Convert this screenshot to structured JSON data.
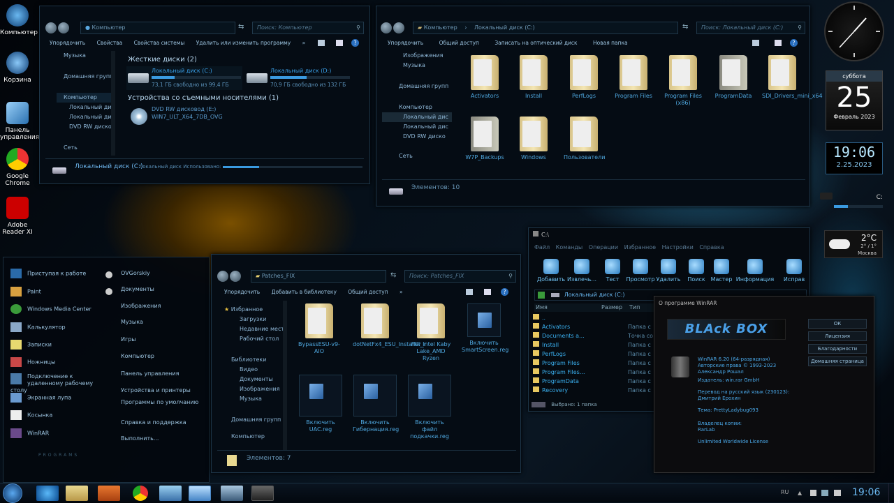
{
  "desktop": {
    "icons": [
      {
        "label": "Компьютер",
        "icon": "computer-icon"
      },
      {
        "label": "Корзина",
        "icon": "recycle-bin-icon"
      },
      {
        "label": "Панель управления",
        "icon": "control-panel-icon"
      },
      {
        "label": "Google Chrome",
        "icon": "chrome-icon"
      },
      {
        "label": "Adobe Reader XI",
        "icon": "adobe-reader-icon"
      }
    ]
  },
  "win_computer": {
    "address": "Компьютер",
    "search": "Поиск: Компьютер",
    "toolbar": [
      "Упорядочить",
      "Свойства",
      "Свойства системы",
      "Удалить или изменить программу",
      "»"
    ],
    "sidebar": [
      "Музыка",
      "Домашняя групп",
      "Компьютер",
      "Локальный диск",
      "Локальный диск",
      "DVD RW диско",
      "Сеть"
    ],
    "hdd_group": "Жесткие диски (2)",
    "removable_group": "Устройства со съемными носителями (1)",
    "drives": [
      {
        "name": "Локальный диск (C:)",
        "free": "73,1 ГБ свободно из 99,4 ГБ",
        "used_fraction": 0.26
      },
      {
        "name": "Локальный диск (D:)",
        "free": "70,9 ГБ свободно из 132 ГБ",
        "used_fraction": 0.46
      }
    ],
    "dvd": {
      "name": "DVD RW дисковод (E:)",
      "label": "WIN7_ULT_X64_7DB_OVG"
    },
    "details_title": "Локальный диск (C:)",
    "details_text": "Локальный диск Использовано:"
  },
  "win_c": {
    "address": [
      "Компьютер",
      "Локальный диск (C:)"
    ],
    "search": "Поиск: Локальный диск (C:)",
    "toolbar": [
      "Упорядочить",
      "Общий доступ",
      "Записать на оптический диск",
      "Новая папка"
    ],
    "sidebar": [
      "Изображения",
      "Музыка",
      "Домашняя групп",
      "Компьютер",
      "Локальный дис",
      "Локальный дис",
      "DVD RW диско",
      "Сеть"
    ],
    "folders": [
      "Activators",
      "Install",
      "PerfLogs",
      "Program Files",
      "Program Files (x86)",
      "ProgramData",
      "SDI_Drivers_mini_x64",
      "W7P_Backups",
      "Windows",
      "Пользователи"
    ],
    "status": "Элементов: 10"
  },
  "win_patches": {
    "address": "Patches_FIX",
    "search": "Поиск: Patches_FIX",
    "toolbar": [
      "Упорядочить",
      "Добавить в библиотеку",
      "Общий доступ",
      "»"
    ],
    "sidebar": [
      "Избранное",
      "Загрузки",
      "Недавние мест",
      "Рабочий стол",
      "Библиотеки",
      "Видео",
      "Документы",
      "Изображения",
      "Музыка",
      "Домашняя групп",
      "Компьютер"
    ],
    "items": [
      "BypassESU-v9-AIO",
      "dotNetFx4_ESU_Installer_r",
      "FIX_Intel Kaby Lake_AMD Ryzen",
      "Включить SmartScreen.reg",
      "Включить UAC.reg",
      "Включить Гибернация.reg",
      "Включить файл подкачки.reg"
    ],
    "status": "Элементов: 7"
  },
  "start_menu": {
    "left": [
      "Приступая к работе",
      "Paint",
      "Windows Media Center",
      "Калькулятор",
      "Записки",
      "Ножницы",
      "Подключение к удаленному рабочему столу",
      "Экранная лупа",
      "Косынка",
      "WinRAR"
    ],
    "right": [
      "OVGorskiy",
      "Документы",
      "Изображения",
      "Музыка",
      "Игры",
      "Компьютер",
      "Панель управления",
      "Устройства и принтеры",
      "Программы по умолчанию",
      "Справка и поддержка",
      "Выполнить..."
    ],
    "footer": "PROGRAMS"
  },
  "winrar": {
    "title": "C:\\",
    "menu": [
      "Файл",
      "Команды",
      "Операции",
      "Избранное",
      "Настройки",
      "Справка"
    ],
    "tools": [
      "Добавить",
      "Извлечь...",
      "Тест",
      "Просмотр",
      "Удалить",
      "Поиск",
      "Мастер",
      "Информация",
      "Исправ"
    ],
    "path": "Локальный диск (C:)",
    "columns": [
      "Имя",
      "Размер",
      "Тип"
    ],
    "rows": [
      {
        "name": "..",
        "type": ""
      },
      {
        "name": "Activators",
        "type": "Папка с"
      },
      {
        "name": "Documents a...",
        "type": "Точка со"
      },
      {
        "name": "Install",
        "type": "Папка с"
      },
      {
        "name": "PerfLogs",
        "type": "Папка с"
      },
      {
        "name": "Program Files",
        "type": "Папка с"
      },
      {
        "name": "Program Files...",
        "type": "Папка с"
      },
      {
        "name": "ProgramData",
        "type": "Папка с"
      },
      {
        "name": "Recovery",
        "type": "Папка с"
      }
    ],
    "status": "Выбрано: 1 папка"
  },
  "about": {
    "title": "О программе WinRAR",
    "logo": "BLAck BOX",
    "lines": [
      "WinRAR 6.20 (64-разрядная)",
      "Авторские права © 1993-2023",
      "Александр Рошал",
      "Издатель: win.rar GmbH",
      "",
      "Перевод на русский язык (230123):",
      "Дмитрий Ерохин",
      "",
      "Тема: PrettyLadybug093",
      "",
      "Владелец копии:",
      "RarLab",
      "",
      "Unlimited Worldwide License"
    ],
    "buttons": [
      "ОК",
      "Лицензия",
      "Благодарности",
      "Домашняя страница"
    ]
  },
  "gadgets": {
    "calendar": {
      "weekday": "суббота",
      "day": "25",
      "month": "Февраль 2023"
    },
    "digital_clock": {
      "time": "19:06",
      "date": "2.25.2023"
    },
    "drive": {
      "label": "C:"
    },
    "weather": {
      "temp": "2°C",
      "range": "2° / 1°",
      "city": "Москва"
    }
  },
  "taskbar": {
    "lang": "RU",
    "time": "19:06"
  }
}
